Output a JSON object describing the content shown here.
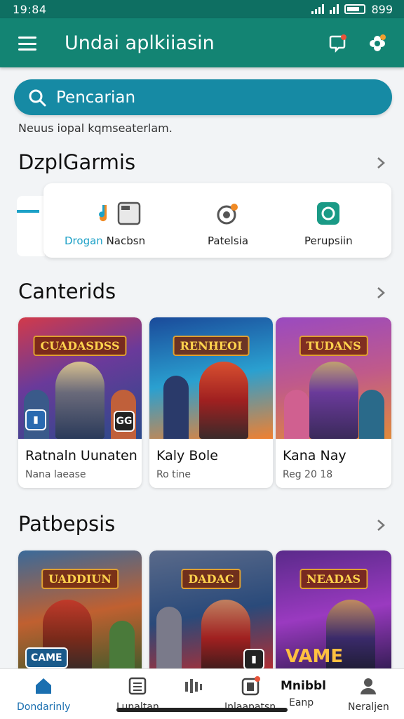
{
  "status_bar": {
    "time": "19:84",
    "battery": "899"
  },
  "app_bar": {
    "title": "Undai aplkiiasin",
    "menu_icon": "hamburger-icon",
    "notification_icon": "notification-icon",
    "profile_icon": "flower-icon"
  },
  "search": {
    "placeholder": "Pencarian",
    "hint": "Neuus iopal kqmseaterlam."
  },
  "sections": {
    "categories": {
      "title": "DzplGarmis"
    },
    "featured": {
      "title": "Canterids"
    },
    "popular": {
      "title": "Patbepsis"
    }
  },
  "categories": [
    {
      "label": "Drogan",
      "icon": "music-note-icon"
    },
    {
      "label": "Nacbsn",
      "icon": "window-icon"
    },
    {
      "label": "Patelsia",
      "icon": "camera-icon"
    },
    {
      "label": "Perupsiin",
      "icon": "shield-icon"
    }
  ],
  "featured_games": [
    {
      "name": "Ratnaln Uunaten",
      "meta": "Nana laease",
      "banner": "CUADASDSS",
      "badge": "GG"
    },
    {
      "name": "Kaly Bole",
      "meta": "Ro tine",
      "banner": "RENHEOI",
      "badge": ""
    },
    {
      "name": "Kana Nay",
      "meta": "Reg 20 18",
      "banner": "TUDANS",
      "badge": ""
    }
  ],
  "popular_games": [
    {
      "banner": "UADDIUN",
      "label": "CAME"
    },
    {
      "banner": "DADAC",
      "label": ""
    },
    {
      "banner": "NEADAS",
      "label": "VAME"
    }
  ],
  "bottom_nav": [
    {
      "label": "Dondarinly",
      "icon": "home-icon",
      "active": true
    },
    {
      "label": "Lunaltan",
      "icon": "list-icon",
      "active": false
    },
    {
      "label": "",
      "icon": "equalizer-icon",
      "active": false
    },
    {
      "label": "Inlaapatsn",
      "icon": "notes-icon",
      "active": false
    },
    {
      "label": "Eanp",
      "icon": "",
      "active": false
    },
    {
      "label": "Neraljen",
      "icon": "person-icon",
      "active": false
    }
  ],
  "bottom_nav_extra": "Mnibbl",
  "colors": {
    "primary": "#138473",
    "status": "#0e6f62",
    "search": "#168aa4",
    "accent": "#1a6fb0"
  }
}
